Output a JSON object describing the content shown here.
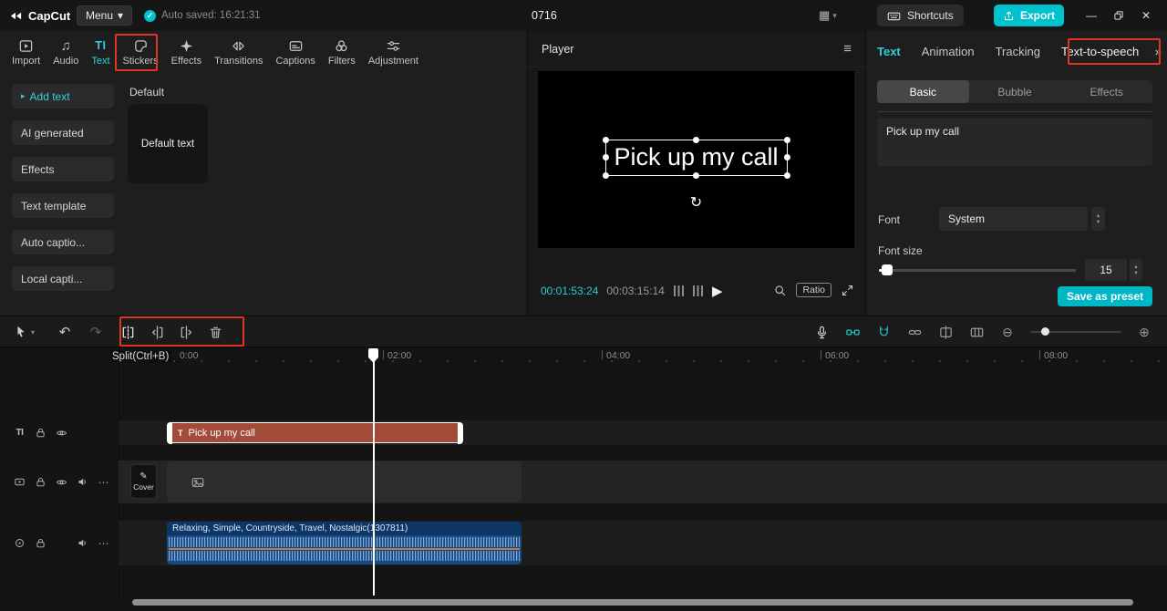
{
  "colors": {
    "accent": "#00c2cc",
    "annotation_red": "#e23327",
    "text_clip": "#a24b38",
    "audio_clip": "#17497f"
  },
  "icons": {
    "menu_caret": "▾",
    "layout_grid": "▦",
    "layout_caret": "▾",
    "minimize_glyph": "—",
    "close_glyph": "✕",
    "check_glyph": "✓",
    "audio_note": "♫",
    "text_tab_glyph": "TI",
    "add_text_marker": "▸",
    "player_menu_glyph": "≡",
    "play_glyph": "▶",
    "rotate_glyph": "↻",
    "overflow_glyph": "»",
    "undo_glyph": "↶",
    "redo_glyph": "↷",
    "zoom_out_glyph": "⊖",
    "zoom_in_glyph": "⊕",
    "more_glyph": "⋯",
    "pencil_glyph": "✎",
    "step_up": "▴",
    "step_down": "▾",
    "text_badge": "T",
    "text_track_glyph": "TI"
  },
  "titlebar": {
    "logo_text": "CapCut",
    "menu_label": "Menu",
    "autosave_text": "Auto saved: 16:21:31",
    "project_title": "0716",
    "shortcuts_label": "Shortcuts",
    "export_label": "Export"
  },
  "media_panel": {
    "tabs": [
      {
        "label": "Import"
      },
      {
        "label": "Audio"
      },
      {
        "label": "Text"
      },
      {
        "label": "Stickers"
      },
      {
        "label": "Effects"
      },
      {
        "label": "Transitions"
      },
      {
        "label": "Captions"
      },
      {
        "label": "Filters"
      },
      {
        "label": "Adjustment"
      }
    ],
    "sidebar": [
      {
        "label": "Add text"
      },
      {
        "label": "AI generated"
      },
      {
        "label": "Effects"
      },
      {
        "label": "Text template"
      },
      {
        "label": "Auto captio..."
      },
      {
        "label": "Local capti..."
      }
    ],
    "section_title": "Default",
    "tile_label": "Default text"
  },
  "player": {
    "title": "Player",
    "overlay_text": "Pick up my call",
    "current_time": "00:01:53:24",
    "duration": "00:03:15:14",
    "ratio_label": "Ratio"
  },
  "properties": {
    "tabs": [
      {
        "label": "Text"
      },
      {
        "label": "Animation"
      },
      {
        "label": "Tracking"
      },
      {
        "label": "Text-to-speech"
      }
    ],
    "subtabs": [
      {
        "label": "Basic"
      },
      {
        "label": "Bubble"
      },
      {
        "label": "Effects"
      }
    ],
    "text_value": "Pick up my call",
    "font_label": "Font",
    "font_value": "System",
    "font_size_label": "Font size",
    "font_size_value": "15",
    "save_preset_label": "Save as preset"
  },
  "timeline": {
    "split_tooltip": "Split(Ctrl+B)",
    "ruler_labels": [
      "0:00",
      "02:00",
      "04:00",
      "06:00",
      "08:00"
    ],
    "cover_label": "Cover",
    "text_clip_label": "Pick up my call",
    "audio_clip_label": "Relaxing, Simple, Countryside, Travel, Nostalgic(1307811)"
  }
}
